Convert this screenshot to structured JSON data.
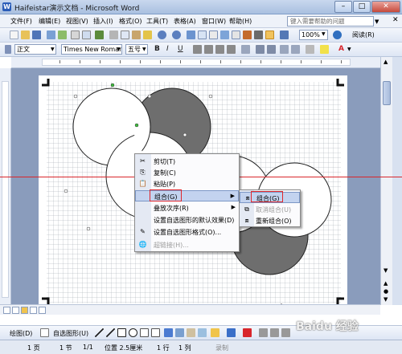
{
  "window": {
    "title": "Haifeistar演示文档 - Microsoft Word",
    "app_icon": "W",
    "minimize": "–",
    "maximize": "□",
    "close": "✕"
  },
  "menubar": {
    "items": [
      "文件(F)",
      "编辑(E)",
      "视图(V)",
      "插入(I)",
      "格式(O)",
      "工具(T)",
      "表格(A)",
      "窗口(W)",
      "帮助(H)"
    ],
    "help_placeholder": "键入需要帮助的问题",
    "close_doc": "✕"
  },
  "toolbar": {
    "zoom": "100%",
    "reading_mode": "阅读(R)"
  },
  "format_toolbar": {
    "style": "正文",
    "font": "Times New Roman",
    "size": "五号",
    "bold": "B",
    "italic": "I",
    "underline": "U",
    "font_color_label": "A"
  },
  "context_menu": {
    "items": [
      {
        "label": "剪切(T)",
        "icon": "cut-icon",
        "glyph": "✂",
        "disabled": false
      },
      {
        "label": "复制(C)",
        "icon": "copy-icon",
        "glyph": "⎘",
        "disabled": false
      },
      {
        "label": "粘贴(P)",
        "icon": "paste-icon",
        "glyph": "📋",
        "disabled": false
      },
      {
        "label": "组合(G)",
        "icon": "",
        "glyph": "",
        "disabled": false,
        "submenu": true,
        "highlighted": true
      },
      {
        "label": "叠放次序(R)",
        "icon": "",
        "glyph": "",
        "disabled": false,
        "submenu": true
      },
      {
        "label": "设置自选图形的默认效果(D)",
        "icon": "",
        "glyph": "",
        "disabled": false
      },
      {
        "label": "设置自选图形格式(O)...",
        "icon": "format-shape-icon",
        "glyph": "✎",
        "disabled": false
      },
      {
        "label": "超链接(H)...",
        "icon": "hyperlink-icon",
        "glyph": "🌐",
        "disabled": true
      }
    ],
    "submenu_arrow": "▶"
  },
  "submenu": {
    "items": [
      {
        "label": "组合(G)",
        "icon": "group-icon",
        "glyph": "⧈",
        "highlighted": true,
        "disabled": false
      },
      {
        "label": "取消组合(U)",
        "icon": "ungroup-icon",
        "glyph": "⧉",
        "disabled": true
      },
      {
        "label": "重新组合(O)",
        "icon": "regroup-icon",
        "glyph": "⧈",
        "disabled": false
      }
    ]
  },
  "drawing_toolbar": {
    "draw_menu": "绘图(D)",
    "autoshapes_menu": "自选图形(U)"
  },
  "statusbar": {
    "page": "1 页",
    "section": "1 节",
    "page_of": "1/1",
    "position": "位置 2.5厘米",
    "line": "1 行",
    "column": "1 列",
    "rec": "录制"
  },
  "watermark": "Baidu 经验",
  "colors": {
    "accent_red": "#d8262c",
    "selection_blue": "#c3d3ef",
    "shape_dark_fill": "#6e6e6e"
  }
}
